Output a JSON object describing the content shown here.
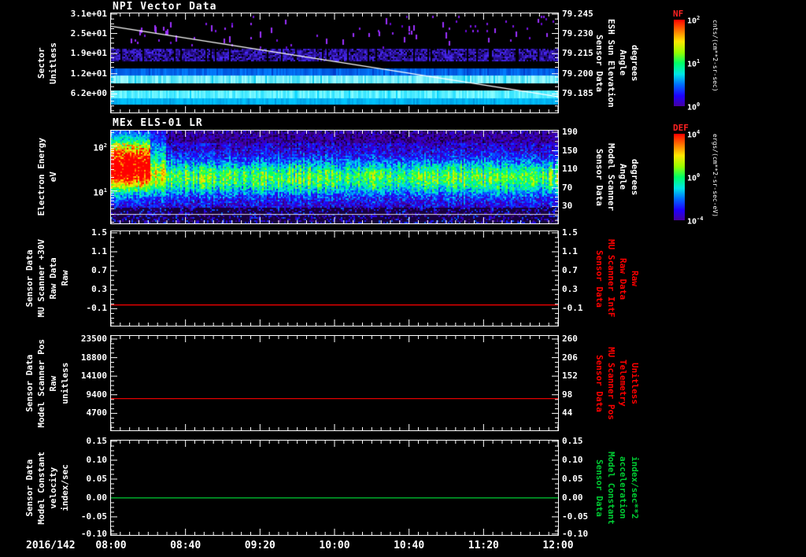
{
  "figure": {
    "background": "#000000",
    "text_color": "#ffffff",
    "x_axis": {
      "date_label": "2016/142",
      "tick_labels": [
        "08:00",
        "08:40",
        "09:20",
        "10:00",
        "10:40",
        "11:20",
        "12:00"
      ],
      "start": "2016/142 08:00",
      "end": "2016/142 12:00"
    },
    "palette": [
      "#05001a",
      "#4600a0",
      "#1e00ff",
      "#006eff",
      "#00e6e6",
      "#00ff64",
      "#96ff00",
      "#ffe600",
      "#ff7800",
      "#ff0000"
    ]
  },
  "chart_data": [
    {
      "type": "heatmap",
      "title": "NPI Vector Data",
      "left_label_lines": [
        "Sector",
        "Unitless"
      ],
      "left_label_color": "#ffffff",
      "left_ticks": [
        {
          "label": "3.1e+01",
          "frac": 0.008
        },
        {
          "label": "2.5e+01",
          "frac": 0.203
        },
        {
          "label": "1.9e+01",
          "frac": 0.406
        },
        {
          "label": "1.2e+01",
          "frac": 0.609
        },
        {
          "label": "6.2e+00",
          "frac": 0.813
        }
      ],
      "right_label_lines": [
        "Sensor Data",
        "ESH Sun Elevation",
        "Angle",
        "degrees"
      ],
      "right_label_color": "#ffffff",
      "right_ticks": [
        {
          "label": "79.245",
          "frac": 0.008
        },
        {
          "label": "79.230",
          "frac": 0.203
        },
        {
          "label": "79.215",
          "frac": 0.406
        },
        {
          "label": "79.200",
          "frac": 0.609
        },
        {
          "label": "79.185",
          "frac": 0.813
        }
      ],
      "colorbar": {
        "name": "NF",
        "unit": "cnts/(cm**2-sr-sec)",
        "ticks": [
          "10^2",
          "10^1",
          "10^0"
        ]
      },
      "overlay_line": {
        "name": "esh-sun-elevation-line",
        "color": "#ffffff",
        "start_frac": 0.13,
        "end_frac": 0.84,
        "start_value": 79.243,
        "end_value": 79.185
      },
      "bands": [
        {
          "style": "sparse-speckle",
          "y0": 0.02,
          "y1": 0.34,
          "color_low": "#5a00c8",
          "color_high": "#9b30ff"
        },
        {
          "style": "speckle",
          "y0": 0.36,
          "y1": 0.475,
          "color_low": "#140050",
          "color_high": "#4b2bff",
          "density": 0.88
        },
        {
          "style": "solid",
          "y0": 0.555,
          "y1": 0.625,
          "color_low": "#0038c8",
          "color_high": "#0080ff"
        },
        {
          "style": "solid",
          "y0": 0.625,
          "y1": 0.71,
          "color_low": "#00c8f0",
          "color_high": "#a8ffff"
        },
        {
          "style": "solid",
          "y0": 0.775,
          "y1": 0.858,
          "color_low": "#00d2ff",
          "color_high": "#8cffff"
        },
        {
          "style": "solid",
          "y0": 0.858,
          "y1": 0.922,
          "color_low": "#0090dc",
          "color_high": "#00c8ff"
        }
      ],
      "features": [
        "scattered purple counts in high sectors",
        "bright cyan bands near sectors 6-12",
        "sun elevation overlay decreasing from 79.243 to 79.185 degrees"
      ]
    },
    {
      "type": "heatmap",
      "title": "MEx ELS-01 LR",
      "left_label_lines": [
        "Electron Energy",
        "eV"
      ],
      "left_label_color": "#ffffff",
      "left_ticks": [
        {
          "label": "10^2",
          "frac": 0.167
        },
        {
          "label": "10^1",
          "frac": 0.65
        }
      ],
      "minor_left_fracs": [
        0.022,
        0.189,
        0.214,
        0.242,
        0.274,
        0.312,
        0.359,
        0.42,
        0.505,
        0.672,
        0.697,
        0.725,
        0.757,
        0.795,
        0.842,
        0.902,
        0.987
      ],
      "right_label_lines": [
        "Sensor Data",
        "Model Scanner",
        "Angle",
        "degrees"
      ],
      "right_label_color": "#ffffff",
      "right_ticks": [
        {
          "label": "190",
          "frac": 0.017
        },
        {
          "label": "150",
          "frac": 0.217
        },
        {
          "label": "110",
          "frac": 0.417
        },
        {
          "label": "70",
          "frac": 0.617
        },
        {
          "label": "30",
          "frac": 0.817
        }
      ],
      "colorbar": {
        "name": "DEF",
        "unit": "ergs/(cm**2-sr-sec-eV)",
        "ticks": [
          "10^4",
          "10^0",
          "10^-4"
        ]
      },
      "els_profile": {
        "base": 0.16,
        "band_peak": 0.42,
        "band_center": 0.5,
        "band_sigma": 0.13,
        "noise": 0.13,
        "bottom_dark_start": 0.82,
        "blob_x_end": 0.085,
        "blob_center": 0.3,
        "blob_sigma": 0.18,
        "blob_boost": 0.75
      },
      "features": [
        "intense red flux enhancement 08:00-08:15 at 20-100 eV",
        "persistent green-cyan band near 15-40 eV across whole interval",
        "blue suprathermal noise above and below band"
      ]
    },
    {
      "type": "line",
      "left_label_lines": [
        "Sensor Data",
        "MU Scanner +30V",
        "Raw Data",
        "Raw"
      ],
      "left_label_color": "#ffffff",
      "left_ticks": [
        {
          "label": "1.5",
          "frac": 0.016
        },
        {
          "label": "1.1",
          "frac": 0.217
        },
        {
          "label": "0.7",
          "frac": 0.418
        },
        {
          "label": "0.3",
          "frac": 0.619
        },
        {
          "label": "-0.1",
          "frac": 0.82
        }
      ],
      "right_label_lines": [
        "Sensor Data",
        "MU Scanner IntF",
        "Raw Data",
        "Raw"
      ],
      "right_label_color": "#ff0000",
      "right_ticks": [
        {
          "label": "1.5",
          "frac": 0.016
        },
        {
          "label": "1.1",
          "frac": 0.217
        },
        {
          "label": "0.7",
          "frac": 0.418
        },
        {
          "label": "0.3",
          "frac": 0.619
        },
        {
          "label": "-0.1",
          "frac": 0.82
        }
      ],
      "line": {
        "name": "mu-scanner-voltage-line",
        "color": "#ff0000",
        "frac": 0.78,
        "value": 0.0
      },
      "series_note": "constant value ~0.0 from 08:00 to 12:00"
    },
    {
      "type": "line",
      "left_label_lines": [
        "Sensor Data",
        "Model Scanner Pos",
        "Raw",
        "unitless"
      ],
      "left_label_color": "#ffffff",
      "left_ticks": [
        {
          "label": "23500",
          "frac": 0.033
        },
        {
          "label": "18800",
          "frac": 0.23
        },
        {
          "label": "14100",
          "frac": 0.426
        },
        {
          "label": "9400",
          "frac": 0.623
        },
        {
          "label": "4700",
          "frac": 0.82
        }
      ],
      "right_label_lines": [
        "Sensor Data",
        "MU Scanner Pos",
        "Telemetry",
        "Unitless"
      ],
      "right_label_color": "#ff0000",
      "right_ticks": [
        {
          "label": "260",
          "frac": 0.033
        },
        {
          "label": "206",
          "frac": 0.23
        },
        {
          "label": "152",
          "frac": 0.426
        },
        {
          "label": "98",
          "frac": 0.623
        },
        {
          "label": "44",
          "frac": 0.82
        }
      ],
      "line": {
        "name": "scanner-pos-line",
        "color": "#ff0000",
        "frac": 0.664,
        "value_left": 8500,
        "value_right": 87
      },
      "series_note": "constant value ~8500 raw (~87 telemetry) from 08:00 to 12:00"
    },
    {
      "type": "line",
      "left_label_lines": [
        "Sensor Data",
        "Model Constant",
        "velocity",
        "index/sec"
      ],
      "left_label_color": "#ffffff",
      "left_ticks": [
        {
          "label": "0.15",
          "frac": 0.008
        },
        {
          "label": "0.10",
          "frac": 0.208
        },
        {
          "label": "0.05",
          "frac": 0.408
        },
        {
          "label": "0.00",
          "frac": 0.608
        },
        {
          "label": "-0.05",
          "frac": 0.808
        },
        {
          "label": "-0.10",
          "frac": 0.99
        }
      ],
      "right_label_lines": [
        "Sensor Data",
        "Model Constant",
        "acceleration",
        "index/sec**2"
      ],
      "right_label_color": "#00cc33",
      "right_ticks": [
        {
          "label": "0.15",
          "frac": 0.008
        },
        {
          "label": "0.10",
          "frac": 0.208
        },
        {
          "label": "0.05",
          "frac": 0.408
        },
        {
          "label": "0.00",
          "frac": 0.608
        },
        {
          "label": "-0.05",
          "frac": 0.808
        },
        {
          "label": "-0.10",
          "frac": 0.99
        }
      ],
      "line": {
        "name": "model-constant-line",
        "color": "#00cc33",
        "frac": 0.607,
        "value": 0.0
      },
      "series_note": "constant value 0.00 from 08:00 to 12:00"
    }
  ]
}
